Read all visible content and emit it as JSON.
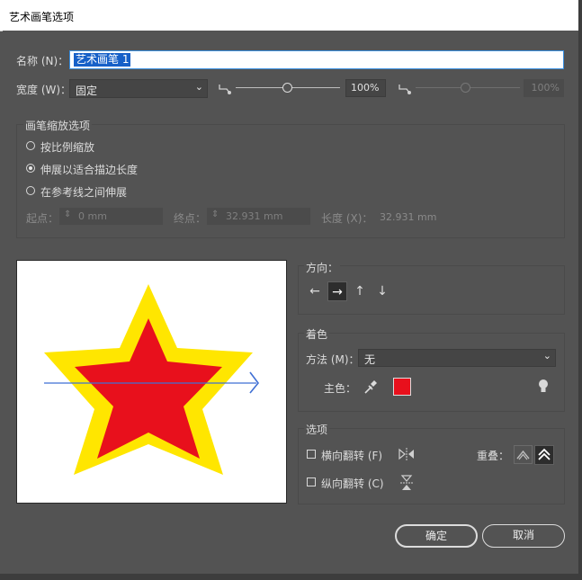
{
  "window": {
    "title": "艺术画笔选项"
  },
  "name": {
    "label": "名称 (N)：",
    "value": "艺术画笔 1"
  },
  "width": {
    "label": "宽度 (W)：",
    "select_value": "固定",
    "value": "100%",
    "value2": "100%"
  },
  "scale": {
    "legend": "画笔缩放选项",
    "options": [
      "按比例缩放",
      "伸展以适合描边长度",
      "在参考线之间伸展"
    ],
    "selected_index": 1,
    "start_label": "起点：",
    "start_value": "0 mm",
    "end_label": "终点：",
    "end_value": "32.931 mm",
    "length_label": "长度 (X)：",
    "length_value": "32.931 mm"
  },
  "direction": {
    "legend": "方向：",
    "buttons": [
      "←",
      "→",
      "↑",
      "↓"
    ],
    "active_index": 1
  },
  "coloring": {
    "legend": "着色",
    "method_label": "方法 (M)：",
    "method_value": "无",
    "key_color_label": "主色：",
    "key_color": "#e8101c"
  },
  "options": {
    "legend": "选项",
    "flip_along_label": "横向翻转 (F)",
    "flip_across_label": "纵向翻转 (C)",
    "overlap_label": "重叠："
  },
  "buttons": {
    "ok": "确定",
    "cancel": "取消"
  },
  "preview": {
    "star_outer": "#ffe600",
    "star_inner": "#e8101c",
    "arrow_color": "#3f6fd4"
  }
}
